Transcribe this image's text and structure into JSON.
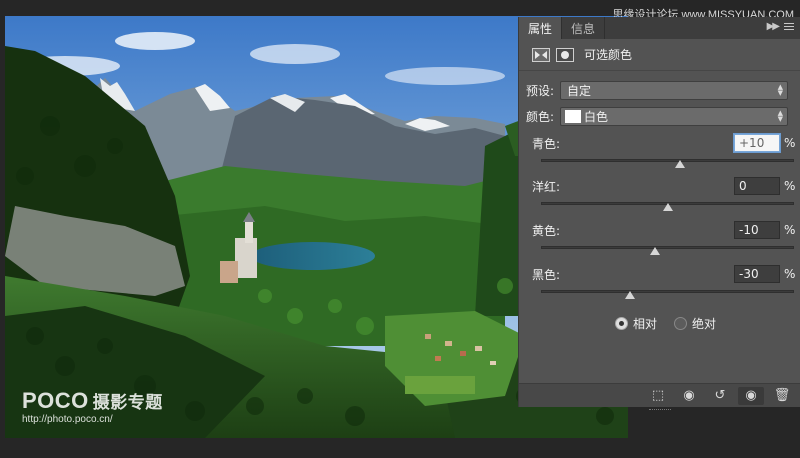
{
  "site_credit": "思缘设计论坛 www.MISSYUAN.COM",
  "watermark": {
    "brand": "POCO",
    "brand_cn": "摄影专题",
    "url": "http://photo.poco.cn/"
  },
  "panel": {
    "tabs": [
      {
        "label": "属性",
        "active": true
      },
      {
        "label": "信息",
        "active": false
      }
    ],
    "title": "可选颜色",
    "preset": {
      "label": "预设:",
      "value": "自定"
    },
    "colors": {
      "label": "颜色:",
      "value": "白色",
      "swatch": "#ffffff"
    },
    "sliders": [
      {
        "label": "青色:",
        "value": "+10",
        "unit": "%",
        "position": 10,
        "focused": true
      },
      {
        "label": "洋红:",
        "value": "0",
        "unit": "%",
        "position": 0,
        "focused": false
      },
      {
        "label": "黄色:",
        "value": "-10",
        "unit": "%",
        "position": -10,
        "focused": false
      },
      {
        "label": "黑色:",
        "value": "-30",
        "unit": "%",
        "position": -30,
        "focused": false
      }
    ],
    "method": {
      "options": [
        {
          "label": "相对",
          "checked": true
        },
        {
          "label": "绝对",
          "checked": false
        }
      ]
    },
    "footer_icons": [
      "clip-to-layer-icon",
      "view-previous-icon",
      "reset-icon",
      "visibility-eye-icon",
      "trash-icon"
    ]
  },
  "colors": {
    "panel_bg": "#535353",
    "tab_bar": "#3d3d3d",
    "focus_ring": "#6b9bd0"
  }
}
